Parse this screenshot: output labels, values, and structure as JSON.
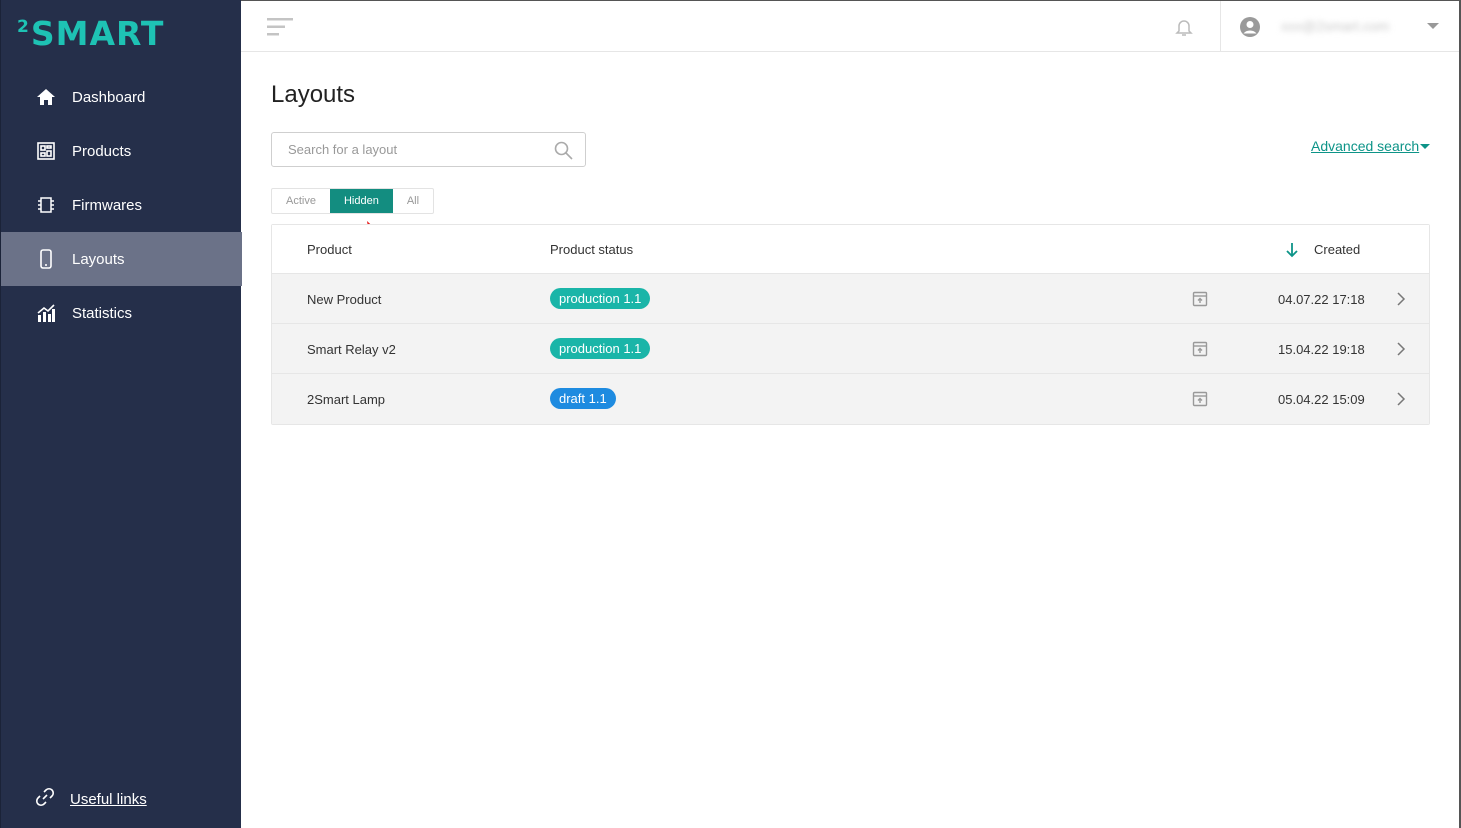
{
  "app": {
    "logo_text": "SMART",
    "logo_prefix": "2"
  },
  "sidebar": {
    "items": [
      {
        "label": "Dashboard",
        "icon": "home-icon"
      },
      {
        "label": "Products",
        "icon": "products-icon"
      },
      {
        "label": "Firmwares",
        "icon": "chip-icon"
      },
      {
        "label": "Layouts",
        "icon": "phone-icon",
        "active": true
      },
      {
        "label": "Statistics",
        "icon": "stats-icon"
      }
    ],
    "useful_links": "Useful links"
  },
  "header": {
    "user_email": "xxx@2smart.com"
  },
  "page": {
    "title": "Layouts",
    "search_placeholder": "Search for a layout",
    "advanced_search": "Advanced search",
    "tabs": [
      "Active",
      "Hidden",
      "All"
    ],
    "active_tab": "Hidden"
  },
  "table": {
    "columns": {
      "product": "Product",
      "status": "Product status",
      "created": "Created"
    },
    "rows": [
      {
        "product": "New Product",
        "status": "production 1.1",
        "status_color": "#1ab5a8",
        "created": "04.07.22 17:18"
      },
      {
        "product": "Smart Relay v2",
        "status": "production 1.1",
        "status_color": "#1ab5a8",
        "created": "15.04.22 19:18"
      },
      {
        "product": "2Smart Lamp",
        "status": "draft 1.1",
        "status_color": "#1e8be0",
        "created": "05.04.22 15:09"
      }
    ]
  },
  "colors": {
    "sidebar_bg": "#252f4a",
    "accent": "#138d80",
    "logo": "#1ec2b4",
    "annotation_arrow": "#e81c1c"
  }
}
